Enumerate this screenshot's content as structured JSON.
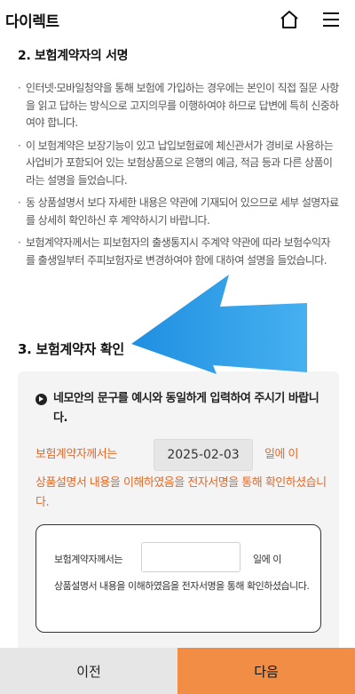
{
  "header": {
    "title": "다이렉트"
  },
  "section2": {
    "title": "2. 보험계약자의 서명",
    "bullets": [
      "인터넷·모바일청약을 통해 보험에 가입하는 경우에는 본인이 직접 질문 사항을 읽고 답하는 방식으로 고지의무를 이행하여야 하므로 답변에 특히 신중하여야 합니다.",
      "이 보험계약은 보장기능이 있고 납입보험료에 체신관서가 경비로 사용하는 사업비가 포함되어 있는 보험상품으로 은행의 예금, 적금 등과 다른 상품이라는 설명을 들었습니다.",
      "동 상품설명서 보다 자세한 내용은 약관에 기재되어 있으므로 세부 설명자료를 상세히 확인하신 후 계약하시기 바랍니다.",
      "보험계약자께서는 피보험자의 출생통지시 주계약 약관에 따라 보험수익자를 출생일부터 주피보험자로 변경하여야 함에 대하여 설명을 들었습니다."
    ]
  },
  "section3": {
    "title": "3. 보험계약자 확인",
    "notice": "네모안의 문구를 예시와 동일하게 입력하여 주시기 바랍니다.",
    "example": {
      "pre": "보험계약자께서는",
      "date": "2025-02-03",
      "post": "일에 이",
      "rest": "상품설명서 내용을 이해하였음을 전자서명을 통해 확인하셨습니다."
    },
    "input": {
      "pre": "보험계약자께서는",
      "value": "",
      "post": "일에 이",
      "rest": "상품설명서 내용을 이해하였음을 전자서명을 통해 확인하셨습니다."
    }
  },
  "footer": {
    "prev_label": "이전",
    "next_label": "다음"
  },
  "colors": {
    "accent": "#f28d45",
    "example_text": "#e16a2a",
    "arrow": "#2f9de8"
  },
  "icons": {
    "home": "home-icon",
    "menu": "menu-icon",
    "notice": "play-circle-icon",
    "overlay": "left-arrow-icon"
  }
}
